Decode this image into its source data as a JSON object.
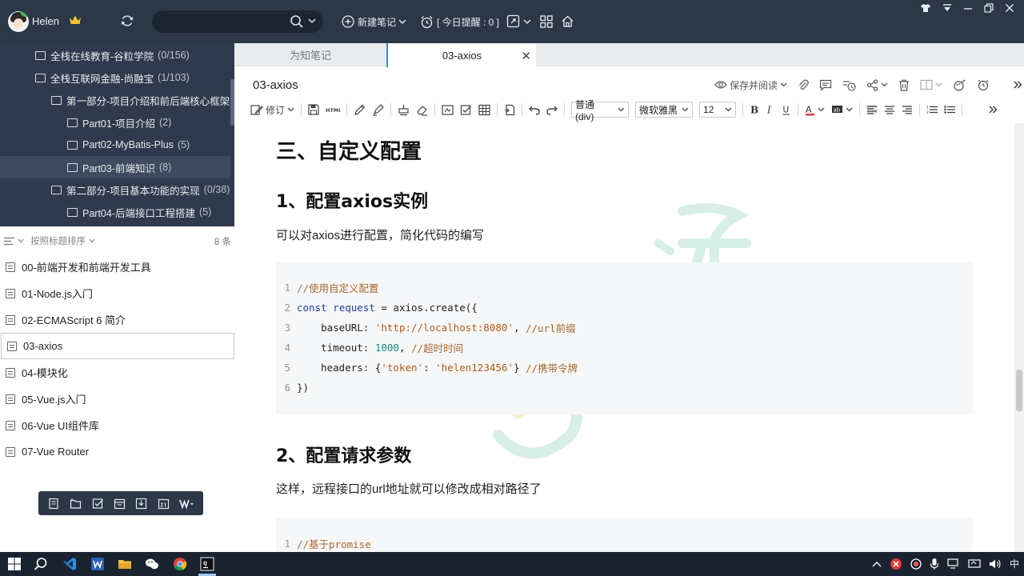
{
  "app": {
    "user_name": "Helen",
    "search_placeholder": "",
    "new_note": "新建笔记",
    "reminder": "[ 今日提醒 : 0 ]"
  },
  "tree": {
    "items": [
      {
        "label": "全栈在线教育-谷粒学院",
        "count": "(0/156)"
      },
      {
        "label": "全栈互联网金融-尚融宝",
        "count": "(1/103)"
      },
      {
        "label": "第一部分-项目介绍和前后端核心框架",
        "count": ""
      },
      {
        "label": "Part01-项目介绍",
        "count": "(2)"
      },
      {
        "label": "Part02-MyBatis-Plus",
        "count": "(5)"
      },
      {
        "label": "Part03-前端知识",
        "count": "(8)"
      },
      {
        "label": "第二部分-项目基本功能的实现",
        "count": "(0/38)"
      },
      {
        "label": "Part04-后端接口工程搭建",
        "count": "(5)"
      }
    ]
  },
  "list": {
    "sort_label": "按照标题排序",
    "count": "8 条",
    "notes": [
      "00-前端开发和前端开发工具",
      "01-Node.js入门",
      "02-ECMAScript 6 简介",
      "03-axios",
      "04-模块化",
      "05-Vue.js入门",
      "06-Vue UI组件库",
      "07-Vue Router"
    ]
  },
  "tabs": [
    {
      "label": "为知笔记"
    },
    {
      "label": "03-axios"
    }
  ],
  "editor": {
    "title": "03-axios",
    "save_read": "保存并阅读",
    "revise": "修订",
    "block_format": "普通 (div)",
    "font_family": "微软雅黑",
    "font_size": "12"
  },
  "doc": {
    "h3": "三、自定义配置",
    "h1_1": "1、配置axios实例",
    "p1": "可以对axios进行配置，简化代码的编写",
    "code1": {
      "ln1": "1",
      "l1": "//使用自定义配置",
      "ln2": "2",
      "l2_kw": "const",
      "l2_var": "request",
      "l2_rest": " = axios.create({",
      "ln3": "3",
      "l3_key": "baseURL: ",
      "l3_str": "'http://localhost:8080'",
      "l3_comma": ", ",
      "l3_com": "//url前缀",
      "ln4": "4",
      "l4_key": "timeout: ",
      "l4_num": "1000",
      "l4_comma": ", ",
      "l4_com": "//超时时间",
      "ln5": "5",
      "l5_key": "headers: {",
      "l5_str1": "'token'",
      "l5_colon": ": ",
      "l5_str2": "'helen123456'",
      "l5_close": "} ",
      "l5_com": "//携带令牌",
      "ln6": "6",
      "l6": "})"
    },
    "h1_2": "2、配置请求参数",
    "p2": "这样，远程接口的url地址就可以修改成相对路径了",
    "code2": {
      "ln1": "1",
      "l1": "//基于promise"
    }
  },
  "taskbar": {
    "ime": "中"
  },
  "colors": {
    "topbar": "#2c3848",
    "sidebar_tree": "#2f3b4c",
    "accent": "#3b88d8",
    "taskbar": "#1b2330"
  }
}
